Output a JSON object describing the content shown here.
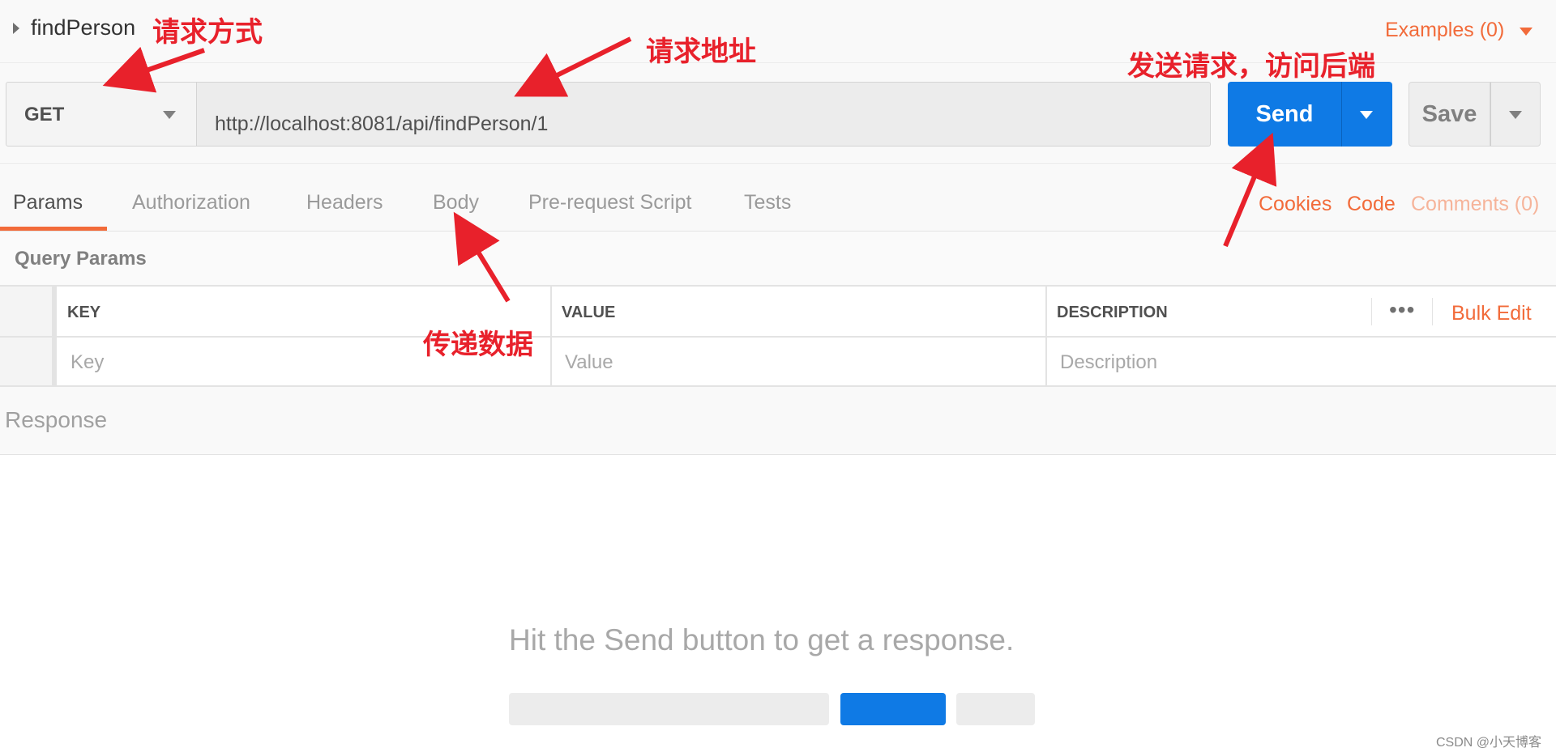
{
  "header": {
    "request_name": "findPerson",
    "examples_label": "Examples (0)"
  },
  "url_bar": {
    "method": "GET",
    "url": "http://localhost:8081/api/findPerson/1",
    "send_label": "Send",
    "save_label": "Save"
  },
  "tabs": [
    {
      "label": "Params",
      "active": true
    },
    {
      "label": "Authorization",
      "active": false
    },
    {
      "label": "Headers",
      "active": false
    },
    {
      "label": "Body",
      "active": false
    },
    {
      "label": "Pre-request Script",
      "active": false
    },
    {
      "label": "Tests",
      "active": false
    }
  ],
  "right_links": {
    "cookies": "Cookies",
    "code": "Code",
    "comments": "Comments (0)"
  },
  "query_params": {
    "title": "Query Params",
    "columns": [
      "KEY",
      "VALUE",
      "DESCRIPTION"
    ],
    "placeholders": [
      "Key",
      "Value",
      "Description"
    ],
    "more_icon": "•••",
    "bulk_edit": "Bulk Edit"
  },
  "response": {
    "title": "Response",
    "hint": "Hit the Send button to get a response."
  },
  "annotations": {
    "method": "请求方式",
    "address": "请求地址",
    "send": "发送请求，访问后端",
    "body": "传递数据"
  },
  "watermark": "CSDN @小天博客",
  "colors": {
    "accent": "#f26b3a",
    "send_blue": "#0f7ae5",
    "annotation_red": "#e8212b"
  }
}
